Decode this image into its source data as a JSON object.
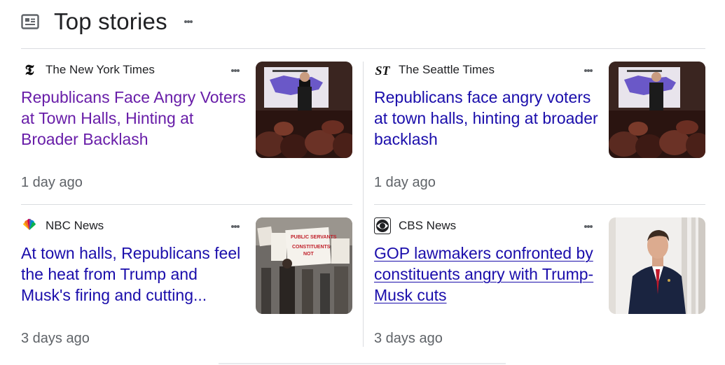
{
  "header": {
    "title": "Top stories",
    "icon": "newspaper-icon",
    "more_icon": "more-vert-icon"
  },
  "colors": {
    "link": "#1a0dab",
    "visited": "#681da8",
    "meta": "#5f6368",
    "divider": "#dadce0"
  },
  "stories": [
    {
      "source": "The New York Times",
      "logo_icon": "nyt-logo-icon",
      "headline": "Republicans Face Angry Voters at Town Halls, Hinting at Broader Backlash",
      "age": "1 day ago",
      "state": "visited",
      "thumbnail": "town-hall-speaker-photo"
    },
    {
      "source": "The Seattle Times",
      "logo_icon": "seattle-times-logo-icon",
      "headline": "Republicans face angry voters at town halls, hinting at broader backlash",
      "age": "1 day ago",
      "state": "default",
      "thumbnail": "town-hall-speaker-photo"
    },
    {
      "source": "NBC News",
      "logo_icon": "nbc-peacock-logo-icon",
      "headline": "At town halls, Republicans feel the heat from Trump and Musk's firing and cutting...",
      "age": "3 days ago",
      "state": "default",
      "thumbnail": "protest-signs-photo",
      "thumbnail_text": [
        "PUBLIC SERVANTS",
        "CONSTITUENTS",
        "NOT"
      ]
    },
    {
      "source": "CBS News",
      "logo_icon": "cbs-eye-logo-icon",
      "headline": "GOP lawmakers confronted by constituents angry with Trump-Musk cuts",
      "age": "3 days ago",
      "state": "hover",
      "thumbnail": "lawmaker-portrait-photo"
    }
  ]
}
